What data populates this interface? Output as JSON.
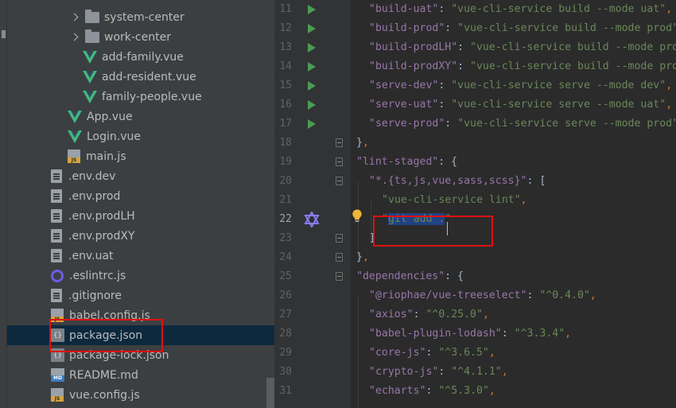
{
  "tree": {
    "items": [
      {
        "label": "system-center",
        "icon": "folder-icon",
        "arrow": true,
        "indent": 1
      },
      {
        "label": "work-center",
        "icon": "folder-icon",
        "arrow": true,
        "indent": 1
      },
      {
        "label": "add-family.vue",
        "icon": "vue-icon",
        "indent": 2
      },
      {
        "label": "add-resident.vue",
        "icon": "vue-icon",
        "indent": 2
      },
      {
        "label": "family-people.vue",
        "icon": "vue-icon",
        "indent": 2
      },
      {
        "label": "App.vue",
        "icon": "vue-icon",
        "indent": 0
      },
      {
        "label": "Login.vue",
        "icon": "vue-icon",
        "indent": 0
      },
      {
        "label": "main.js",
        "icon": "js-icon",
        "indent": 0
      },
      {
        "label": ".env.dev",
        "icon": "file-icon",
        "indent": -1
      },
      {
        "label": ".env.prod",
        "icon": "file-icon",
        "indent": -1
      },
      {
        "label": ".env.prodLH",
        "icon": "file-icon",
        "indent": -1
      },
      {
        "label": ".env.prodXY",
        "icon": "file-icon",
        "indent": -1
      },
      {
        "label": ".env.uat",
        "icon": "file-icon",
        "indent": -1
      },
      {
        "label": ".eslintrc.js",
        "icon": "eslint-icon",
        "indent": -1
      },
      {
        "label": ".gitignore",
        "icon": "file-icon",
        "indent": -1
      },
      {
        "label": "babel.config.js",
        "icon": "js-icon",
        "indent": -1
      },
      {
        "label": "package.json",
        "icon": "json-icon",
        "indent": -1,
        "selected": true
      },
      {
        "label": "package-lock.json",
        "icon": "json-icon",
        "indent": -1
      },
      {
        "label": "README.md",
        "icon": "md-icon",
        "indent": -1
      },
      {
        "label": "vue.config.js",
        "icon": "js-icon",
        "indent": -1
      }
    ]
  },
  "editor": {
    "current_line": "22",
    "lines": [
      {
        "n": "11",
        "run": true,
        "tokens": [
          [
            "s2",
            ""
          ],
          [
            "k",
            "\"build-uat\""
          ],
          [
            "t",
            ": "
          ],
          [
            "s",
            "\"vue-cli-service build --mode uat\""
          ],
          [
            "p",
            ","
          ]
        ]
      },
      {
        "n": "12",
        "run": true,
        "tokens": [
          [
            "k",
            "\"build-prod\""
          ],
          [
            "t",
            ": "
          ],
          [
            "s",
            "\"vue-cli-service build --mode prod\""
          ],
          [
            "p",
            ","
          ]
        ]
      },
      {
        "n": "13",
        "run": true,
        "tokens": [
          [
            "k",
            "\"build-prodLH\""
          ],
          [
            "t",
            ": "
          ],
          [
            "s",
            "\"vue-cli-service build --mode prodLH\""
          ],
          [
            "p",
            ","
          ]
        ]
      },
      {
        "n": "14",
        "run": true,
        "tokens": [
          [
            "k",
            "\"build-prodXY\""
          ],
          [
            "t",
            ": "
          ],
          [
            "s",
            "\"vue-cli-service build --mode prodXY\""
          ],
          [
            "p",
            ","
          ]
        ]
      },
      {
        "n": "15",
        "run": true,
        "tokens": [
          [
            "k",
            "\"serve-dev\""
          ],
          [
            "t",
            ": "
          ],
          [
            "s",
            "\"vue-cli-service serve --mode dev\""
          ],
          [
            "p",
            ","
          ]
        ]
      },
      {
        "n": "16",
        "run": true,
        "tokens": [
          [
            "k",
            "\"serve-uat\""
          ],
          [
            "t",
            ": "
          ],
          [
            "s",
            "\"vue-cli-service serve --mode uat\""
          ],
          [
            "p",
            ","
          ]
        ]
      },
      {
        "n": "17",
        "run": true,
        "tokens": [
          [
            "k",
            "\"serve-prod\""
          ],
          [
            "t",
            ": "
          ],
          [
            "s",
            "\"vue-cli-service serve --mode prod\""
          ]
        ]
      },
      {
        "n": "18",
        "fold": true,
        "tokens": [
          [
            "t",
            "}"
          ],
          [
            "p",
            ","
          ]
        ]
      },
      {
        "n": "19",
        "fold": true,
        "tokens": [
          [
            "k",
            "\"lint-staged\""
          ],
          [
            "t",
            ": {"
          ]
        ]
      },
      {
        "n": "20",
        "fold": true,
        "tokens": [
          [
            "k",
            "\"*.{ts,js,vue,sass,scss}\""
          ],
          [
            "t",
            ": ["
          ]
        ]
      },
      {
        "n": "21",
        "tokens": [
          [
            "s",
            "\"vue-cli-service lint\""
          ],
          [
            "p",
            ","
          ]
        ]
      },
      {
        "n": "22",
        "prettier": true,
        "bulb": true,
        "tokens": [
          [
            "s",
            "\""
          ],
          [
            "sel",
            "git add ."
          ],
          [
            "s",
            "\""
          ]
        ]
      },
      {
        "n": "23",
        "fold": true,
        "tokens": [
          [
            "t",
            "]"
          ]
        ]
      },
      {
        "n": "24",
        "fold": true,
        "tokens": [
          [
            "t",
            "}"
          ],
          [
            "p",
            ","
          ]
        ]
      },
      {
        "n": "25",
        "fold": true,
        "tokens": [
          [
            "k",
            "\"dependencies\""
          ],
          [
            "t",
            ": {"
          ]
        ]
      },
      {
        "n": "26",
        "tokens": [
          [
            "k",
            "\"@riophae/vue-treeselect\""
          ],
          [
            "t",
            ": "
          ],
          [
            "s",
            "\"^0.4.0\""
          ],
          [
            "p",
            ","
          ]
        ]
      },
      {
        "n": "27",
        "tokens": [
          [
            "k",
            "\"axios\""
          ],
          [
            "t",
            ": "
          ],
          [
            "s",
            "\"^0.25.0\""
          ],
          [
            "p",
            ","
          ]
        ]
      },
      {
        "n": "28",
        "tokens": [
          [
            "k",
            "\"babel-plugin-lodash\""
          ],
          [
            "t",
            ": "
          ],
          [
            "s",
            "\"^3.3.4\""
          ],
          [
            "p",
            ","
          ]
        ]
      },
      {
        "n": "29",
        "tokens": [
          [
            "k",
            "\"core-js\""
          ],
          [
            "t",
            ": "
          ],
          [
            "s",
            "\"^3.6.5\""
          ],
          [
            "p",
            ","
          ]
        ]
      },
      {
        "n": "30",
        "tokens": [
          [
            "k",
            "\"crypto-js\""
          ],
          [
            "t",
            ": "
          ],
          [
            "s",
            "\"^4.1.1\""
          ],
          [
            "p",
            ","
          ]
        ]
      },
      {
        "n": "31",
        "tokens": [
          [
            "k",
            "\"echarts\""
          ],
          [
            "t",
            ": "
          ],
          [
            "s",
            "\"^5.3.0\""
          ],
          [
            "p",
            ","
          ]
        ]
      }
    ]
  },
  "colors": {
    "annotation": "#e01010",
    "selection": "#214283",
    "key": "#9876aa",
    "string": "#6a8759"
  }
}
